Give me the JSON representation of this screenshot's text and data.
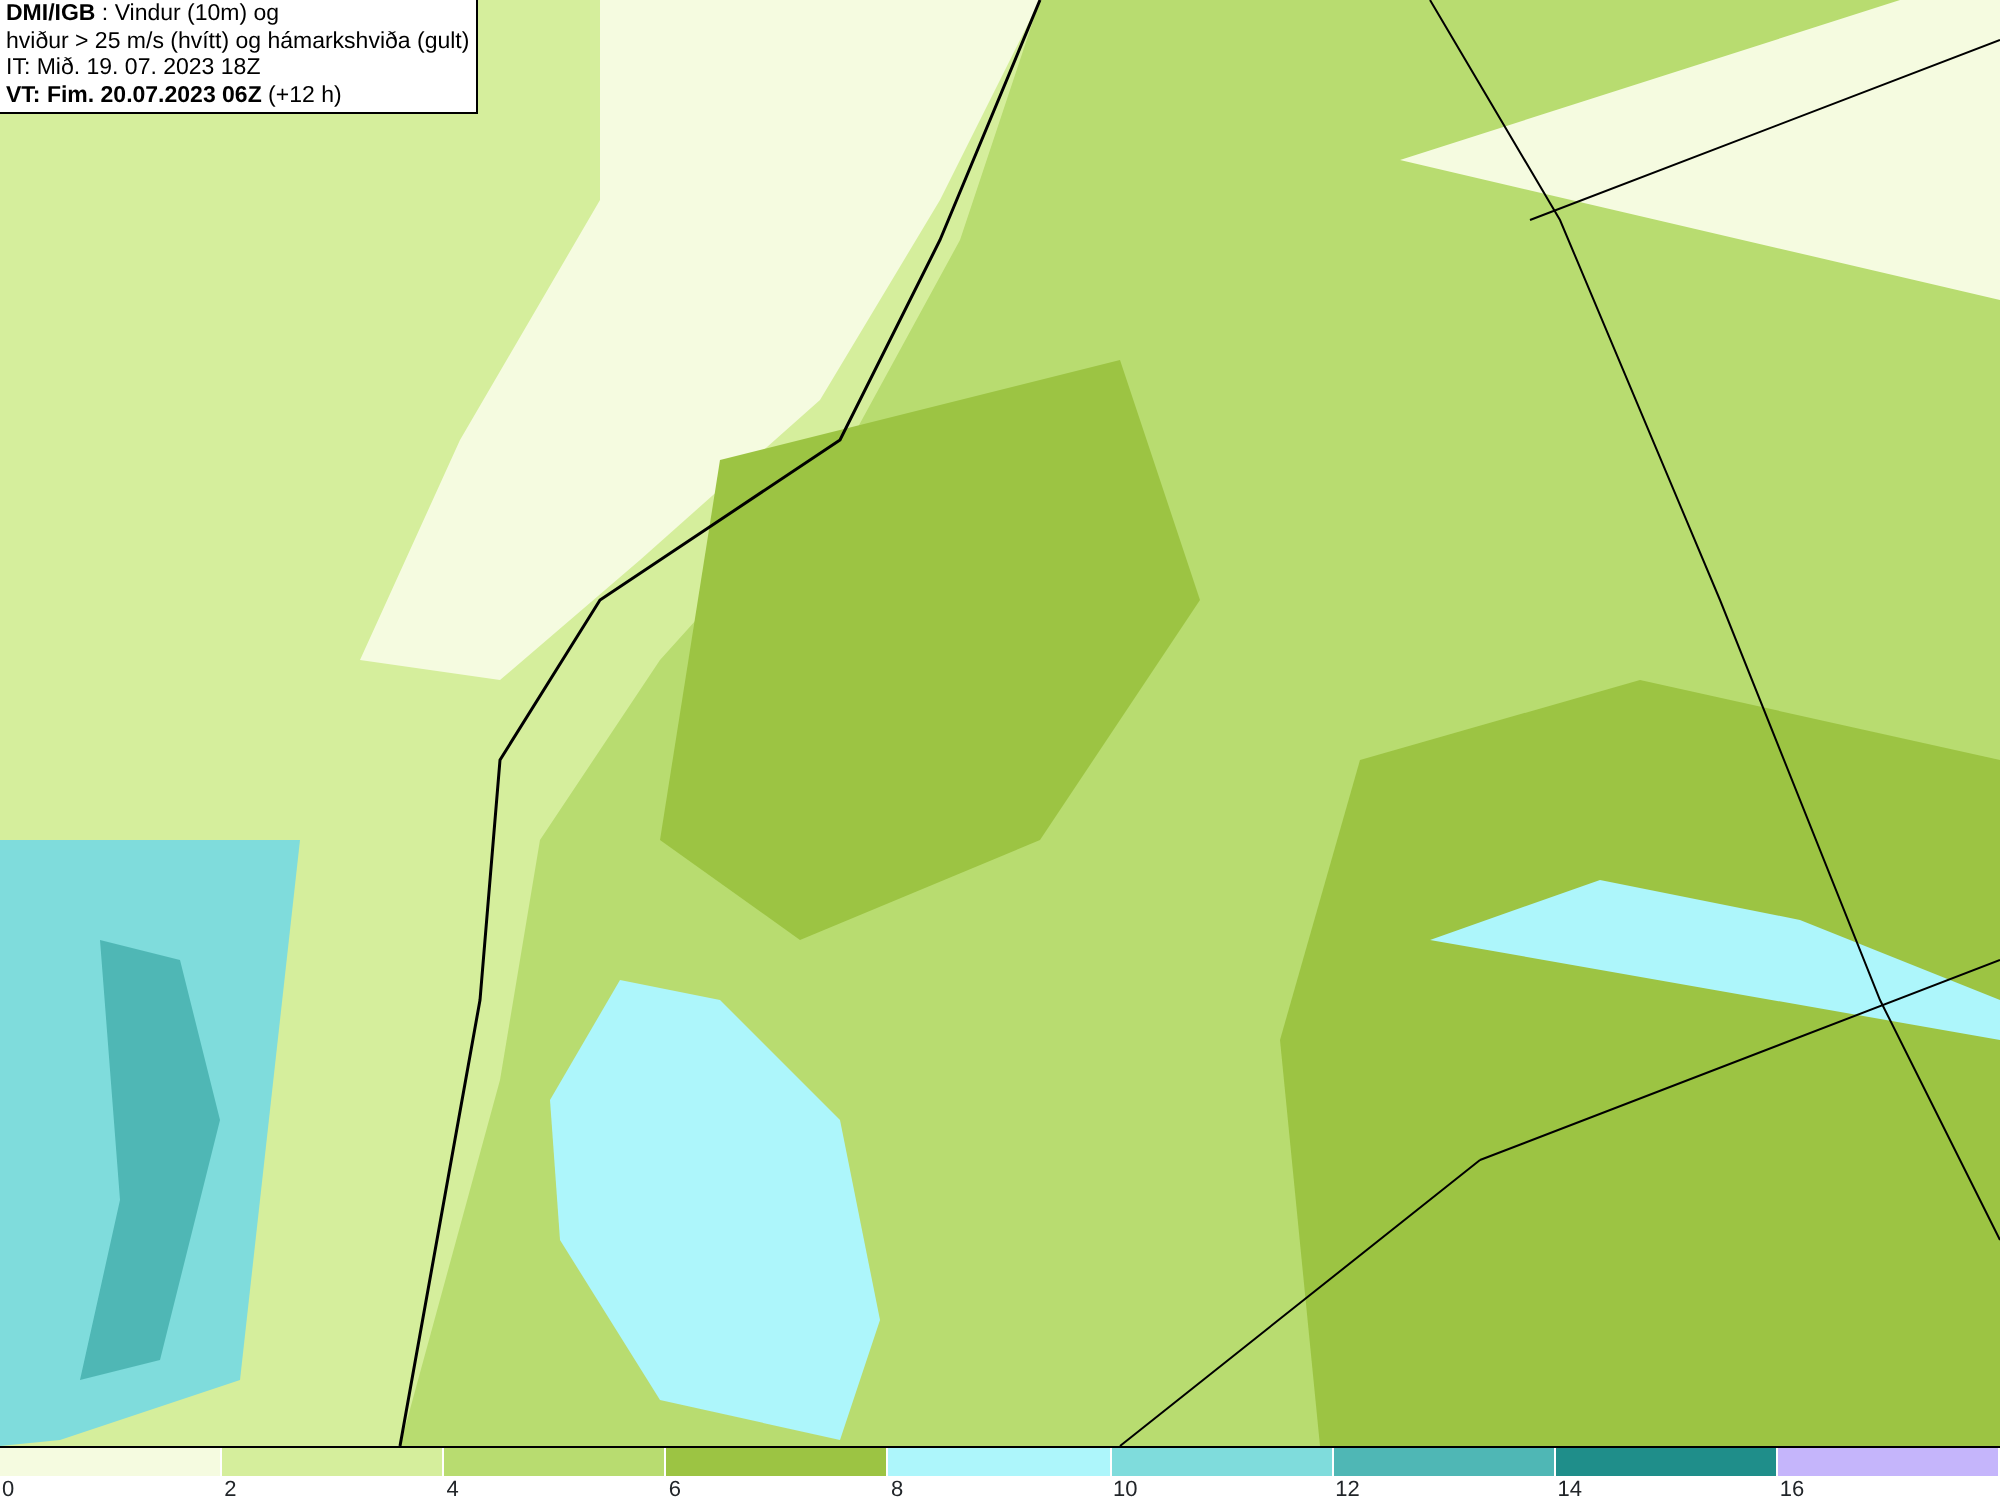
{
  "header": {
    "lines": [
      "**DMI/IGB** : Vindur (10m) og",
      "hviður > 25 m/s (hvítt) og hámarkshviða (gult)",
      "IT: Mið. 19. 07. 2023 18Z",
      "**VT: Fim. 20.07.2023 06Z** (+12 h)"
    ]
  },
  "legend": {
    "bins": [
      {
        "color": "#f5fbe0",
        "label": "0"
      },
      {
        "color": "#d5ee9c",
        "label": "2"
      },
      {
        "color": "#b8dc70",
        "label": "4"
      },
      {
        "color": "#9cc443",
        "label": "6"
      },
      {
        "color": "#adf6fb",
        "label": "8"
      },
      {
        "color": "#7fdcdc",
        "label": "10"
      },
      {
        "color": "#4fb7b5",
        "label": "12"
      },
      {
        "color": "#1f8e8a",
        "label": "14"
      },
      {
        "color": "#c5b5fb",
        "label": "16"
      }
    ]
  }
}
